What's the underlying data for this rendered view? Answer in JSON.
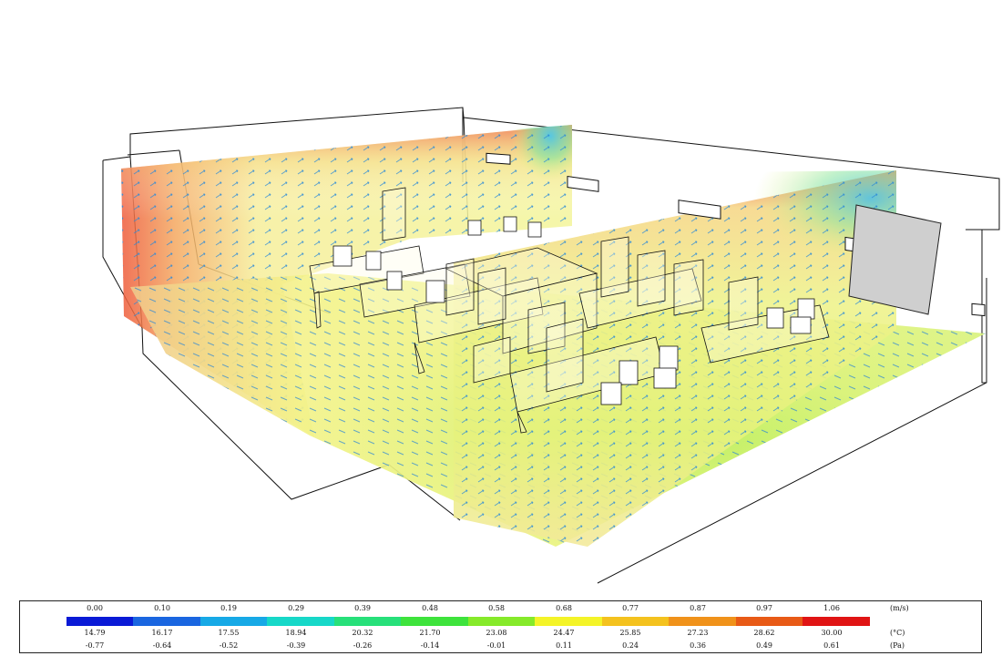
{
  "legend": {
    "velocity": {
      "unit": "(m/s)",
      "values": [
        "0.00",
        "0.10",
        "0.19",
        "0.29",
        "0.39",
        "0.48",
        "0.58",
        "0.68",
        "0.77",
        "0.87",
        "0.97",
        "1.06"
      ]
    },
    "temperature": {
      "unit": "(°C)",
      "values": [
        "14.79",
        "16.17",
        "17.55",
        "18.94",
        "20.32",
        "21.70",
        "23.08",
        "24.47",
        "25.85",
        "27.23",
        "28.62",
        "30.00"
      ]
    },
    "pressure": {
      "unit": "(Pa)",
      "values": [
        "-0.77",
        "-0.64",
        "-0.52",
        "-0.39",
        "-0.26",
        "-0.14",
        "-0.01",
        "0.11",
        "0.24",
        "0.36",
        "0.49",
        "0.61"
      ]
    },
    "colors": [
      "#0a1ad6",
      "#1a66e0",
      "#17a9e6",
      "#17d8c8",
      "#27e07a",
      "#3ee33c",
      "#86ea2a",
      "#f4f428",
      "#f4c21e",
      "#f0921a",
      "#e85a16",
      "#e01414"
    ]
  }
}
